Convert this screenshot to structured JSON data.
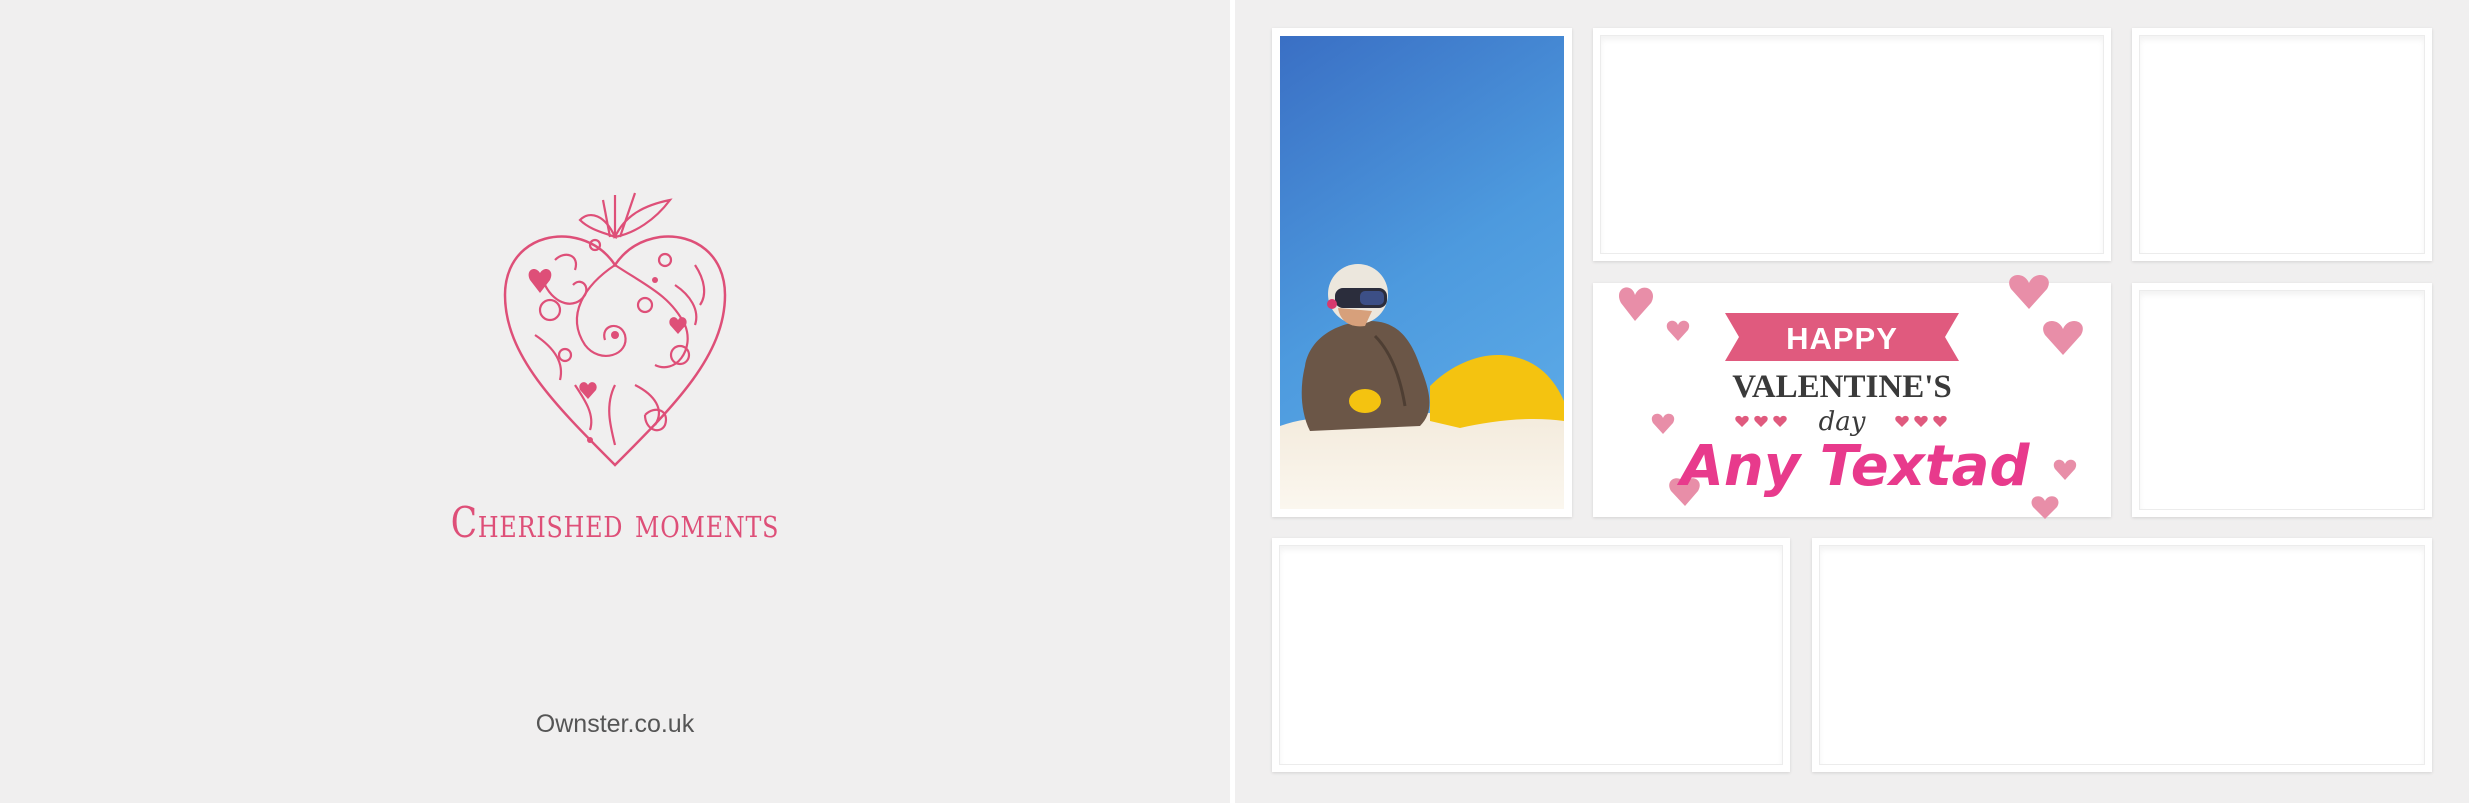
{
  "cover": {
    "title": "Cherished moments",
    "brand": "Ownster.co.uk",
    "heart_icon": "ornate-heart-icon",
    "accent_color": "#de4f78"
  },
  "valentine_card": {
    "banner": "HAPPY",
    "line1": "VALENTINE'S",
    "line2": "day",
    "custom_text": "Any Textad",
    "banner_color": "#e05a7e",
    "custom_text_color": "#e83a8c",
    "heart_color": "#e88ea8"
  },
  "photo": {
    "description_icon": "snowboarder-photo"
  },
  "frames": {
    "empty_count_label": ""
  }
}
